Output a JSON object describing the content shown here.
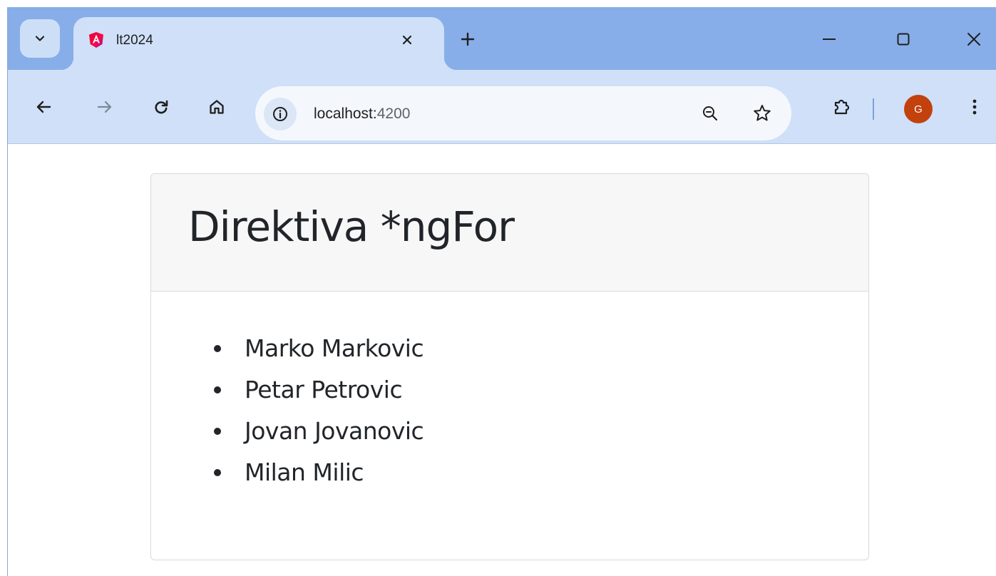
{
  "browser": {
    "tab": {
      "title": "lt2024",
      "favicon": "angular-logo-icon"
    },
    "address_bar": {
      "host": "localhost:",
      "port": "4200"
    },
    "profile_initial": "G"
  },
  "page": {
    "title": "Direktiva *ngFor",
    "people": [
      "Marko Markovic",
      "Petar Petrovic",
      "Jovan Jovanovic",
      "Milan Milic"
    ]
  }
}
